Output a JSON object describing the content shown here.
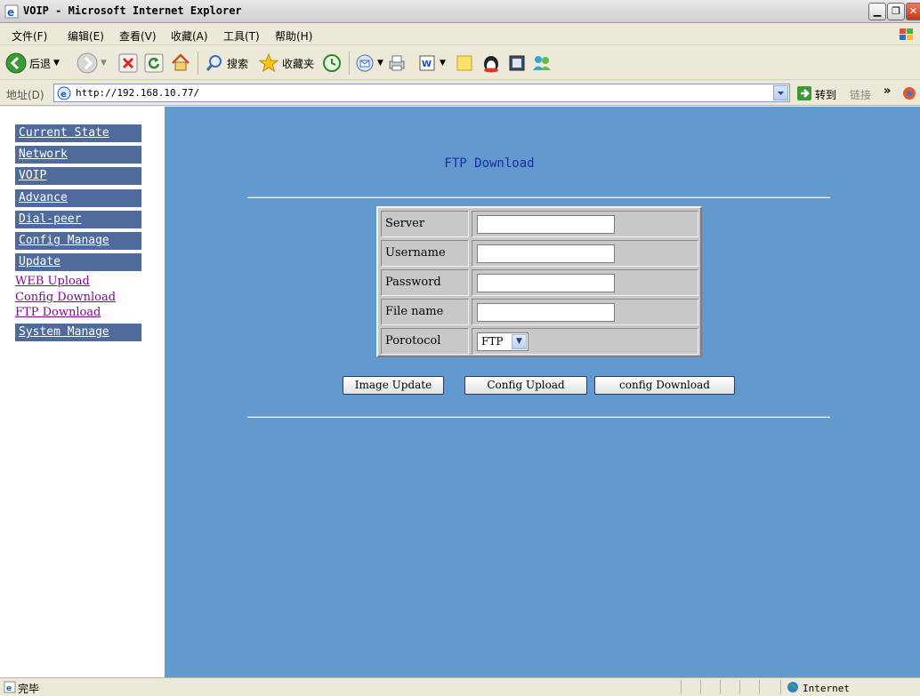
{
  "window": {
    "title": "VOIP - Microsoft Internet Explorer",
    "controls": [
      "minimize",
      "maximize",
      "close"
    ]
  },
  "menu": {
    "items": [
      "文件(F)",
      "编辑(E)",
      "查看(V)",
      "收藏(A)",
      "工具(T)",
      "帮助(H)"
    ]
  },
  "toolbar": {
    "back_label": "后退",
    "search_label": "搜索",
    "favorites_label": "收藏夹"
  },
  "address": {
    "label": "地址(D)",
    "url": "http://192.168.10.77/",
    "go_label": "转到",
    "links_label": "链接"
  },
  "sidebar": {
    "items": [
      "Current State",
      "Network",
      "VOIP",
      "Advance",
      "Dial-peer",
      "Config Manage",
      "Update"
    ],
    "update_sublinks": [
      "WEB Upload",
      "Config Download",
      "FTP Download"
    ],
    "last_item": "System Manage"
  },
  "main": {
    "heading": "FTP Download",
    "form": {
      "server_label": "Server",
      "server_value": "",
      "username_label": "Username",
      "username_value": "",
      "password_label": "Password",
      "password_value": "",
      "filename_label": "File name",
      "filename_value": "",
      "protocol_label": "Porotocol",
      "protocol_value": "FTP"
    },
    "buttons": {
      "image_update": "Image Update",
      "config_upload": "Config Upload",
      "config_download": "config Download"
    }
  },
  "status": {
    "text": "完毕",
    "zone": "Internet"
  },
  "colors": {
    "main_background": "#6299cf",
    "nav_button": "#4f6b9c",
    "heading": "#1a2f9e",
    "visited_link": "#7a0a8a"
  }
}
